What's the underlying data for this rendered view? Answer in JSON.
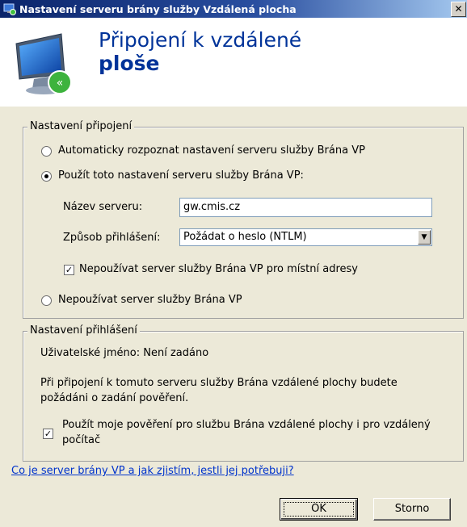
{
  "window": {
    "title": "Nastavení serveru brány služby Vzdálená plocha",
    "close_glyph": "✕"
  },
  "header": {
    "title_line1": "Připojení k vzdálené",
    "title_line2": "ploše"
  },
  "connection": {
    "legend": "Nastavení připojení",
    "radio_auto": {
      "label": "Automaticky rozpoznat nastavení serveru služby Brána VP",
      "checked": false
    },
    "radio_use": {
      "label": "Použít toto nastavení serveru služby Brána VP:",
      "checked": true
    },
    "server_name_label": "Název serveru:",
    "server_name_value": "gw.cmis.cz",
    "logon_method_label": "Způsob přihlášení:",
    "logon_method_value": "Požádat o heslo (NTLM)",
    "bypass_local": {
      "label": "Nepoužívat server služby Brána VP pro místní adresy",
      "checked": true
    },
    "radio_none": {
      "label": "Nepoužívat server služby Brána VP",
      "checked": false
    }
  },
  "logon": {
    "legend": "Nastavení přihlášení",
    "username_text": "Uživatelské jméno:  Není zadáno",
    "info_line1": "Při připojení k tomuto serveru služby Brána vzdálené plochy budete",
    "info_line2": "požádáni o zadání pověření.",
    "use_creds": {
      "label_line1": "Použít moje pověření pro službu Brána vzdálené plochy i pro vzdálený",
      "label_line2": "počítač",
      "checked": true
    }
  },
  "help_link": "Co je server brány VP a jak zjistím, jestli jej potřebuji?",
  "buttons": {
    "ok": "OK",
    "cancel": "Storno"
  },
  "icons": {
    "title": "rdp-gateway-icon",
    "header": "remote-desktop-monitor-icon",
    "dropdown": "dropdown-arrow-icon"
  }
}
